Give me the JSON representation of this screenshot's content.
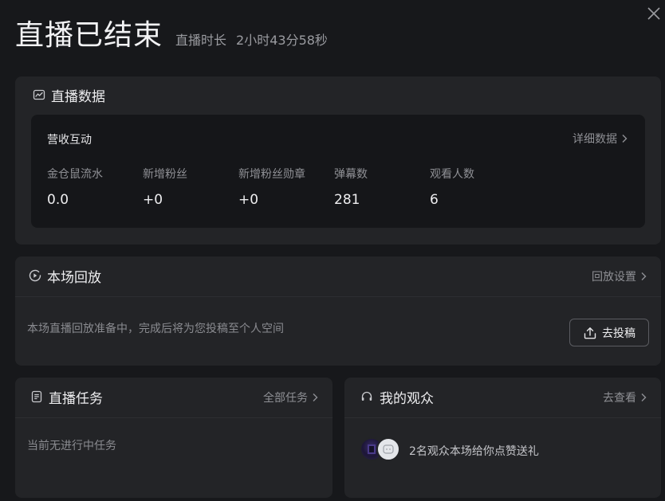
{
  "header": {
    "title": "直播已结束",
    "duration_label": "直播时长",
    "duration_value": "2小时43分58秒"
  },
  "icons": {
    "close": "close-icon",
    "chart": "trend-chart-icon",
    "replay": "play-circle-icon",
    "upload": "upload-icon",
    "tasks": "document-icon",
    "viewers": "headset-icon",
    "chevron": "chevron-right-icon"
  },
  "stats": {
    "title": "直播数据",
    "subtitle": "营收互动",
    "detail_link": "详细数据",
    "metrics": [
      {
        "label": "金仓鼠流水",
        "value": "0.0"
      },
      {
        "label": "新增粉丝",
        "value": "+0"
      },
      {
        "label": "新增粉丝勋章",
        "value": "+0"
      },
      {
        "label": "弹幕数",
        "value": "281"
      },
      {
        "label": "观看人数",
        "value": "6"
      }
    ]
  },
  "replay": {
    "title": "本场回放",
    "settings_link": "回放设置",
    "message": "本场直播回放准备中，完成后将为您投稿至个人空间",
    "upload_button": "去投稿"
  },
  "tasks": {
    "title": "直播任务",
    "all_link": "全部任务",
    "empty_message": "当前无进行中任务"
  },
  "viewers": {
    "title": "我的观众",
    "view_link": "去查看",
    "message": "2名观众本场给你点赞送礼"
  },
  "colors": {
    "background": "#17181b",
    "card": "#232427",
    "inner_panel": "#151619",
    "muted_text": "#8f9095"
  }
}
